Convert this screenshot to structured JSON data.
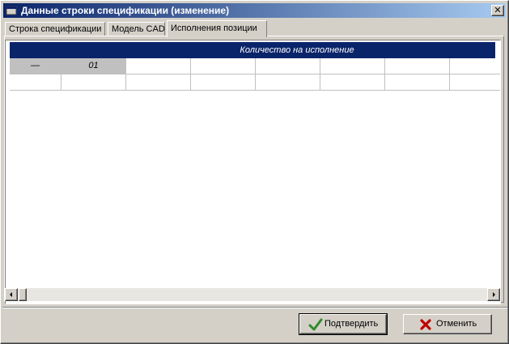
{
  "window": {
    "title": "Данные строки спецификации (изменение)",
    "close_glyph": "✕"
  },
  "tabs": [
    {
      "label": "Строка спецификации",
      "active": false
    },
    {
      "label": "Модель CAD",
      "active": false
    },
    {
      "label": "Исполнения позиции",
      "active": true
    }
  ],
  "grid": {
    "header_title": "Количество на исполнение",
    "fixed_cell": "—",
    "columns": [
      "01",
      "",
      "",
      "",
      "",
      "",
      ""
    ],
    "rows": [
      [
        "",
        "",
        "",
        "",
        "",
        "",
        "",
        ""
      ]
    ]
  },
  "scrollbar": {
    "left_icon": "scroll-left-icon",
    "right_icon": "scroll-right-icon"
  },
  "buttons": {
    "confirm_label": "Подтвердить",
    "confirm_icon": "check-icon",
    "cancel_label": "Отменить",
    "cancel_icon": "cross-icon"
  },
  "colors": {
    "title_bar": "#0a246a",
    "header_bg": "#0a246a",
    "check": "#2e8b2e",
    "cross": "#c00000"
  }
}
